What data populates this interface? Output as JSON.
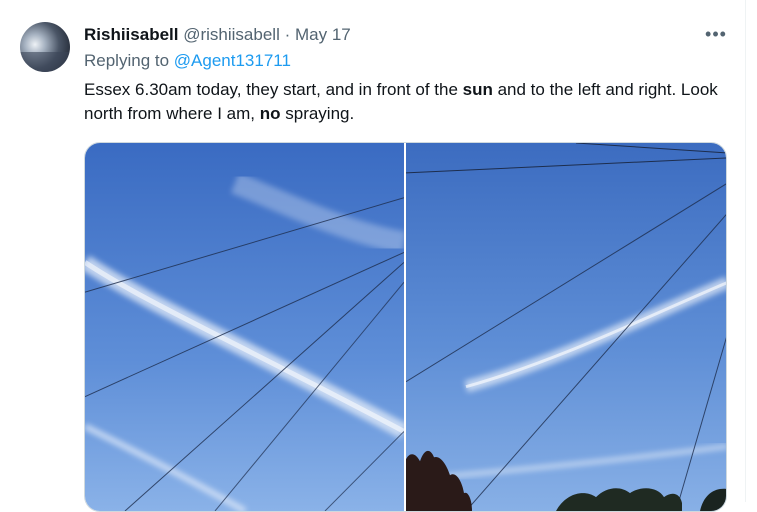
{
  "tweet": {
    "author_name": "Rishiisabell",
    "author_handle": "@rishiisabell",
    "separator": "·",
    "date": "May 17",
    "more_icon": "more-horizontal-icon",
    "reply_prefix": "Replying to",
    "reply_mention": "@Agent131711",
    "text_part1": "Essex 6.30am today, they start, and in front of the ",
    "text_bold1": "sun",
    "text_part2": " and to the left and right. Look north from where I am, ",
    "text_bold2": "no",
    "text_part3": " spraying."
  },
  "colors": {
    "text": "#0f1419",
    "secondary": "#536471",
    "link": "#1d9bf0",
    "sky_top": "#3d6fc4",
    "sky_bottom": "#8fb6ea"
  }
}
